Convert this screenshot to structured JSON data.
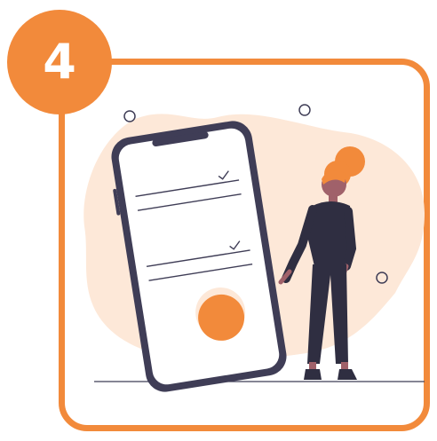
{
  "step": {
    "number": "4",
    "badge_color": "#F28A3B"
  },
  "illustration": {
    "name": "person-with-phone-checklist",
    "blob_color": "#FDE8D8",
    "phone_frame_color": "#3F3D56",
    "accent_color": "#F28A3B",
    "checklist_items": 2
  }
}
